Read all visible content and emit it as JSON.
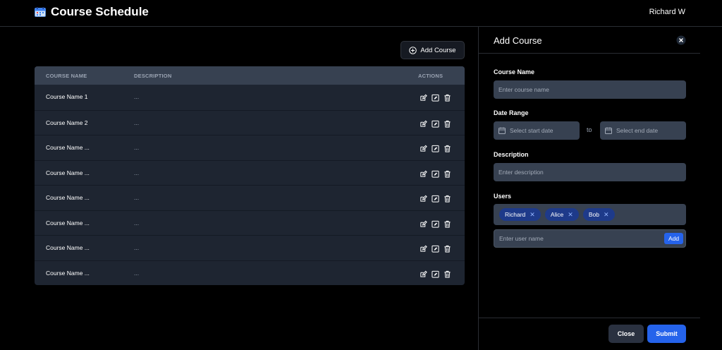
{
  "header": {
    "title": "Course Schedule",
    "user": "Richard W",
    "logo_icon": "calendar-icon"
  },
  "toolbar": {
    "add_course_label": "Add Course",
    "add_course_icon": "plus-circle-icon"
  },
  "table": {
    "columns": [
      "COURSE NAME",
      "DESCRIPTION",
      "ACTIONS"
    ],
    "rows": [
      {
        "name": "Course Name 1",
        "description": "..."
      },
      {
        "name": "Course Name 2",
        "description": "..."
      },
      {
        "name": "Course Name ...",
        "description": "..."
      },
      {
        "name": "Course Name ...",
        "description": "..."
      },
      {
        "name": "Course Name ...",
        "description": "..."
      },
      {
        "name": "Course Name ...",
        "description": "..."
      },
      {
        "name": "Course Name ...",
        "description": "..."
      },
      {
        "name": "Course Name ...",
        "description": "..."
      }
    ],
    "action_icons": [
      "edit-icon",
      "schedule-edit-icon",
      "trash-icon"
    ]
  },
  "panel": {
    "title": "Add Course",
    "course_name_label": "Course Name",
    "course_name_placeholder": "Enter course name",
    "date_range_label": "Date Range",
    "start_placeholder": "Select start date",
    "to_text": "to",
    "end_placeholder": "Select end date",
    "description_label": "Description",
    "description_placeholder": "Enter description",
    "users_label": "Users",
    "users": [
      "Richard",
      "Alice",
      "Bob"
    ],
    "user_input_placeholder": "Enter user name",
    "add_user_label": "Add",
    "close_label": "Close",
    "submit_label": "Submit"
  },
  "colors": {
    "background": "#000000",
    "table_bg": "#1e2531",
    "table_header_bg": "#374151",
    "field_bg": "#374151",
    "accent": "#2563eb",
    "chip_bg": "#1e3a8a"
  }
}
